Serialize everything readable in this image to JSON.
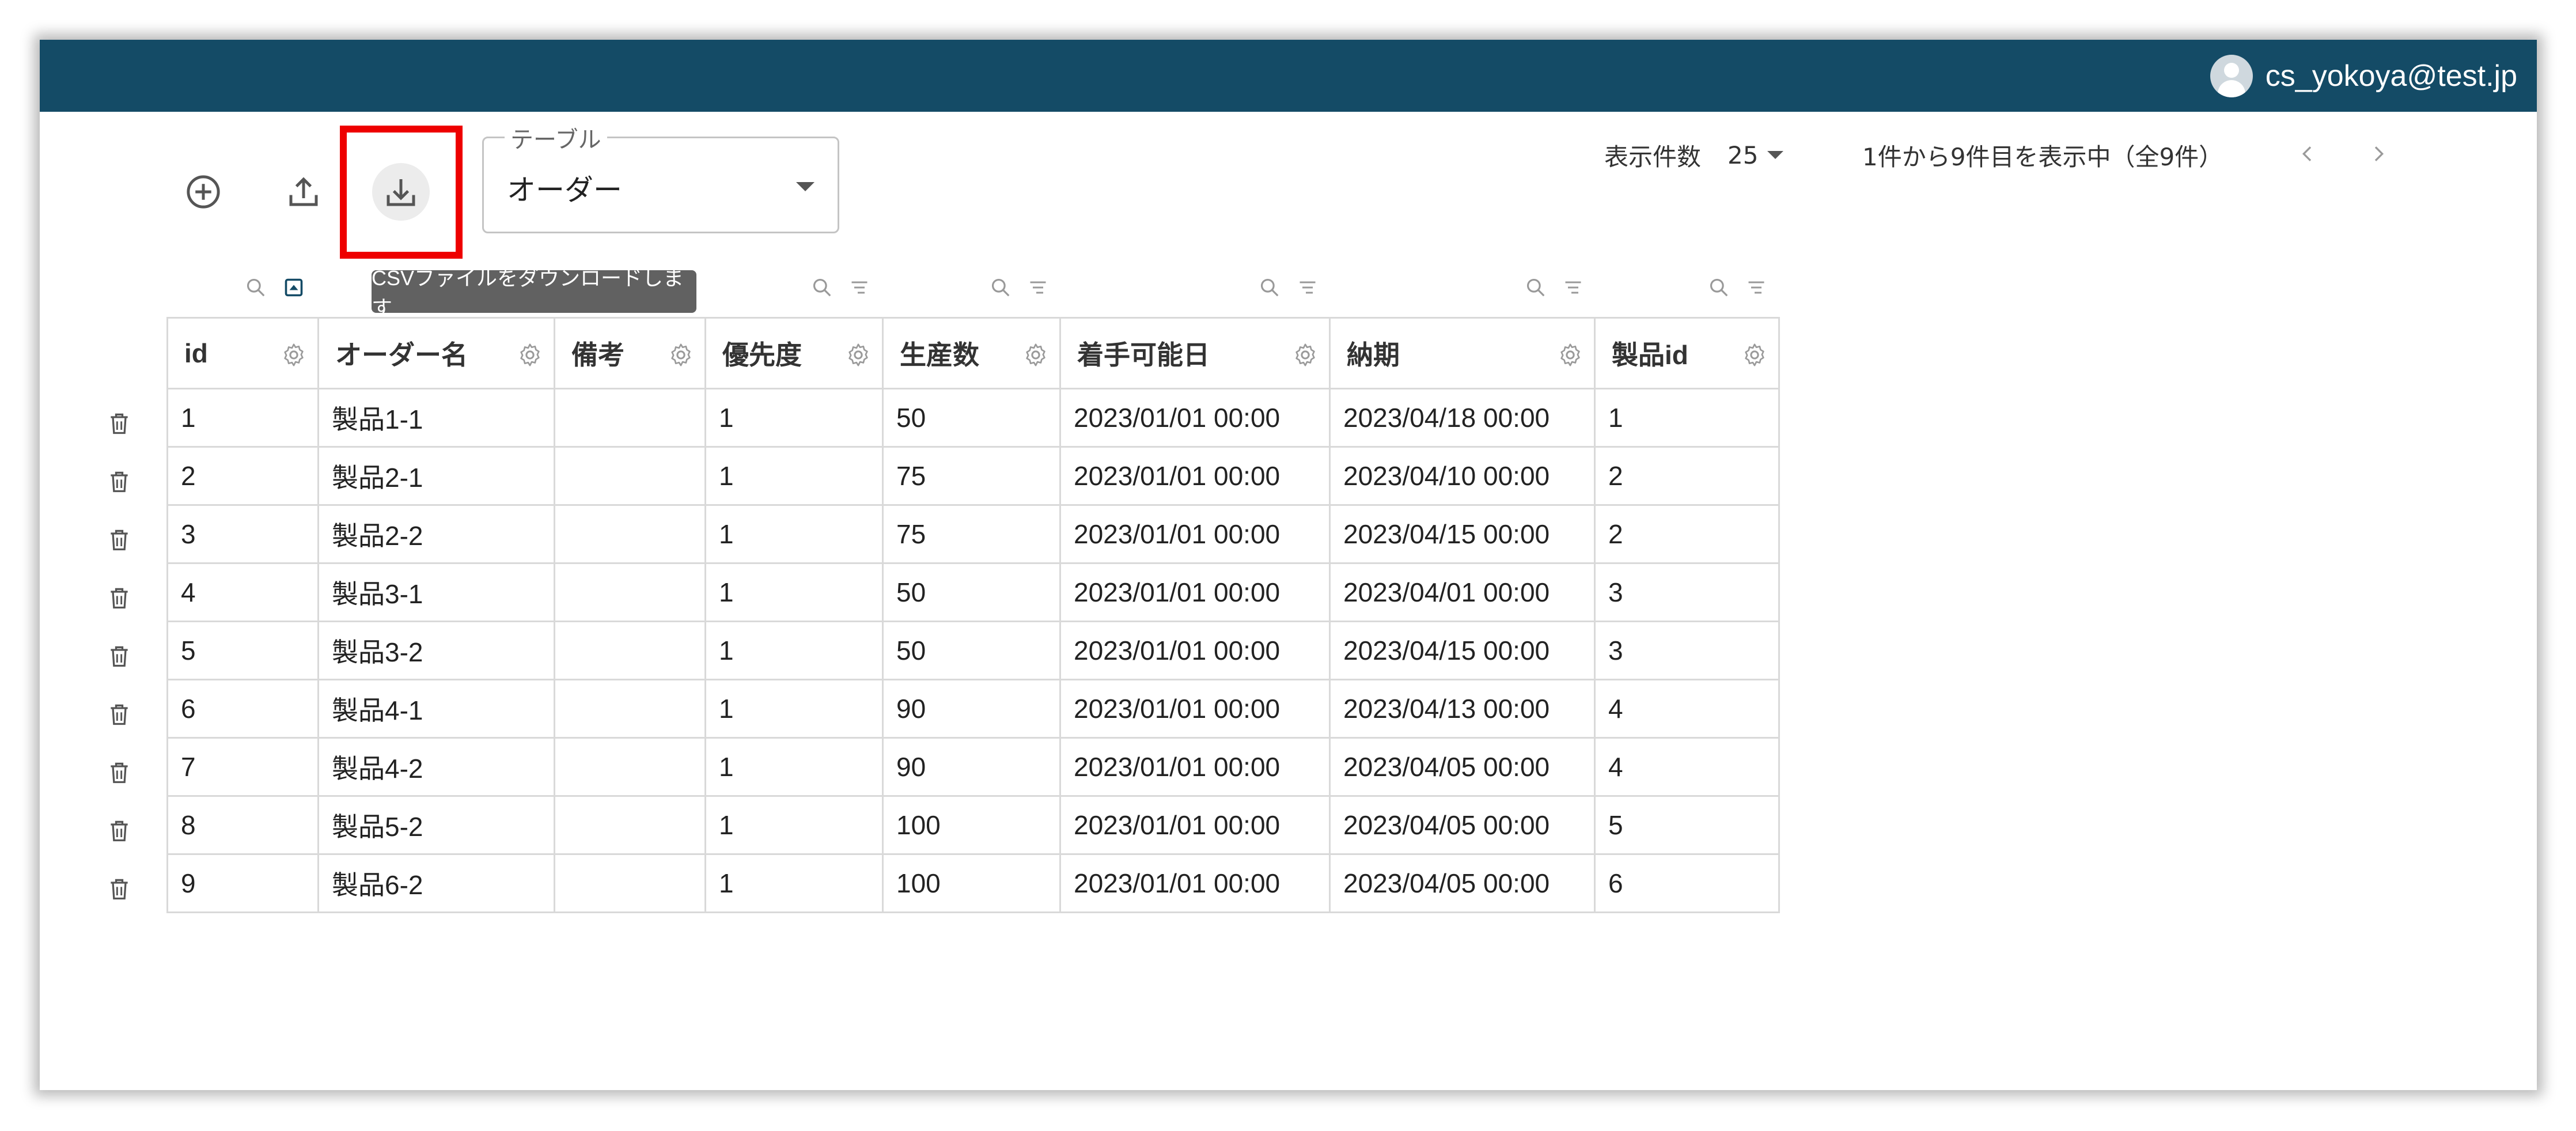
{
  "header": {
    "user_email": "cs_yokoya@test.jp"
  },
  "toolbar": {
    "add_icon": "add-circle-icon",
    "upload_icon": "upload-icon",
    "download_icon": "download-icon",
    "download_tooltip": "CSVファイルをダウンロードします"
  },
  "table_select": {
    "label": "テーブル",
    "value": "オーダー"
  },
  "pagination": {
    "rows_label": "表示件数",
    "rows_value": "25",
    "range_text": "1件から9件目を表示中（全9件）"
  },
  "colors": {
    "appbar": "#144b66",
    "highlight": "#ee0000",
    "tooltip": "#616161"
  },
  "table": {
    "columns": [
      "id",
      "オーダー名",
      "備考",
      "優先度",
      "生産数",
      "着手可能日",
      "納期",
      "製品id"
    ],
    "rows": [
      [
        "1",
        "製品1-1",
        "",
        "1",
        "50",
        "2023/01/01 00:00",
        "2023/04/18 00:00",
        "1"
      ],
      [
        "2",
        "製品2-1",
        "",
        "1",
        "75",
        "2023/01/01 00:00",
        "2023/04/10 00:00",
        "2"
      ],
      [
        "3",
        "製品2-2",
        "",
        "1",
        "75",
        "2023/01/01 00:00",
        "2023/04/15 00:00",
        "2"
      ],
      [
        "4",
        "製品3-1",
        "",
        "1",
        "50",
        "2023/01/01 00:00",
        "2023/04/01 00:00",
        "3"
      ],
      [
        "5",
        "製品3-2",
        "",
        "1",
        "50",
        "2023/01/01 00:00",
        "2023/04/15 00:00",
        "3"
      ],
      [
        "6",
        "製品4-1",
        "",
        "1",
        "90",
        "2023/01/01 00:00",
        "2023/04/13 00:00",
        "4"
      ],
      [
        "7",
        "製品4-2",
        "",
        "1",
        "90",
        "2023/01/01 00:00",
        "2023/04/05 00:00",
        "4"
      ],
      [
        "8",
        "製品5-2",
        "",
        "1",
        "100",
        "2023/01/01 00:00",
        "2023/04/05 00:00",
        "5"
      ],
      [
        "9",
        "製品6-2",
        "",
        "1",
        "100",
        "2023/01/01 00:00",
        "2023/04/05 00:00",
        "6"
      ]
    ]
  }
}
